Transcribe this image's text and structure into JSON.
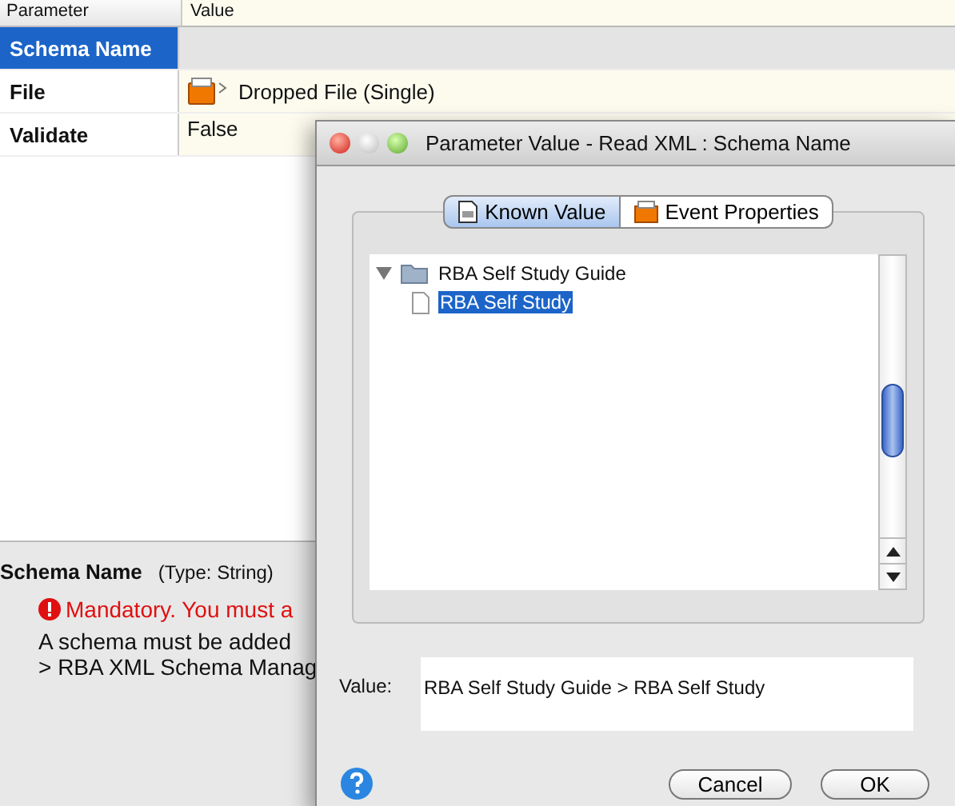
{
  "table": {
    "columns": [
      "Parameter",
      "Value"
    ],
    "rows": [
      {
        "name": "Schema Name",
        "value": "",
        "kind": "empty",
        "selected": true
      },
      {
        "name": "File",
        "value": "Dropped File (Single)",
        "kind": "file",
        "selected": false
      },
      {
        "name": "Validate",
        "value": "False",
        "kind": "text",
        "selected": false
      }
    ]
  },
  "details": {
    "title": "Schema Name",
    "type": "(Type: String)",
    "error": "Mandatory. You must a",
    "description": [
      "A schema must be added",
      "> RBA XML Schema Manag"
    ]
  },
  "dialog": {
    "title": "Parameter Value - Read XML : Schema Name",
    "tabs": [
      {
        "label": "Known Value",
        "kind": "text",
        "selected": true
      },
      {
        "label": "Event Properties",
        "kind": "file",
        "selected": false
      }
    ],
    "tree": [
      {
        "label": "RBA Self Study Guide",
        "kind": "folder",
        "expanded": true,
        "selected": false,
        "children": [
          {
            "label": "RBA Self Study",
            "kind": "file",
            "selected": true
          }
        ]
      }
    ],
    "value_label": "Value:",
    "value": "RBA Self Study Guide > RBA Self Study",
    "buttons": [
      "Cancel",
      "OK"
    ]
  }
}
